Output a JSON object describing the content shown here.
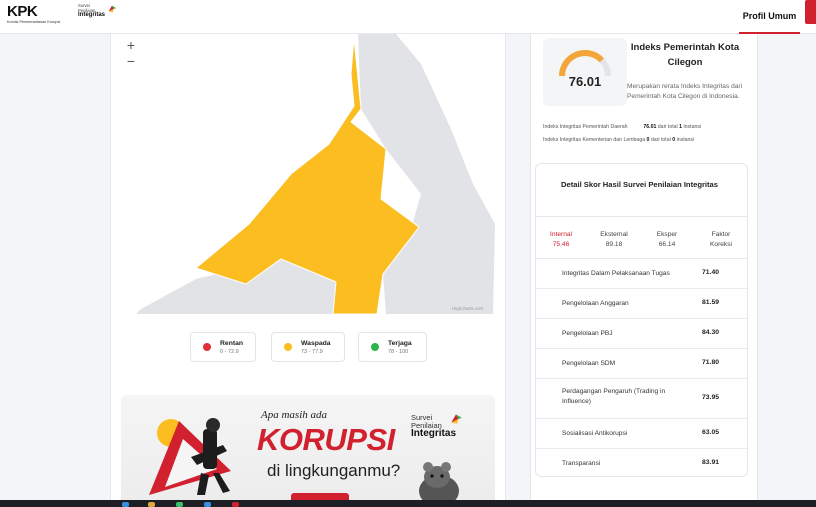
{
  "header": {
    "kpk_logo_text": "KPK",
    "kpk_logo_sub": "Komisi Pemberantasan Korupsi",
    "spi_logo": {
      "line1": "Survei",
      "line2": "Penilaian",
      "line3": "Integritas"
    },
    "nav_active": "Profil Umum",
    "accent_color": "#d1202e"
  },
  "map": {
    "zoom_in": "+",
    "zoom_out": "−",
    "credit": "Highcharts.com",
    "region_color": "#fbbd1f",
    "neighbor_color": "#e2e3e6"
  },
  "legend": [
    {
      "label": "Rentan",
      "range": "0 - 72.9",
      "color": "#e0303a"
    },
    {
      "label": "Waspada",
      "range": "73 - 77.9",
      "color": "#fbbd1f"
    },
    {
      "label": "Terjaga",
      "range": "78 - 100",
      "color": "#2bb54a"
    }
  ],
  "banner": {
    "tagline": "Apa masih ada",
    "headline": "KORUPSI",
    "subline": "di lingkunganmu?",
    "logo": {
      "line1": "Survei",
      "line2": "Penilaian",
      "line3": "Integritas"
    }
  },
  "index": {
    "value": "76.01",
    "title": "Indeks Pemerintah Kota Cilegon",
    "description": "Merupakan rerata Indeks Integritas dari Pemerintah Kota Cilegon di Indonesia.",
    "line1_label": "Indeks Integritas Pemerintah Daerah",
    "line1_value": "76.01",
    "line1_suffix": "dari total",
    "line1_count": "1",
    "line1_unit": "instansi",
    "line2_label": "Indeks Integritas Kementerian dan Lembaga",
    "line2_value": "0",
    "line2_suffix": "dari total",
    "line2_count": "0",
    "line2_unit": "instansi",
    "gauge_fraction": 0.7601
  },
  "detail": {
    "title": "Detail Skor Hasil Survei Penilaian Integritas",
    "tabs": [
      {
        "label": "Internal",
        "value": "75.46",
        "active": true
      },
      {
        "label": "Eksternal",
        "value": "89.18",
        "active": false
      },
      {
        "label": "Eksper",
        "value": "66.14",
        "active": false
      },
      {
        "label": "Faktor",
        "value": "Koreksi",
        "active": false
      }
    ],
    "rows": [
      {
        "name": "Integritas Dalam Pelaksanaan Tugas",
        "value": "71.40"
      },
      {
        "name": "Pengelolaan Anggaran",
        "value": "81.59"
      },
      {
        "name": "Pengelolaan PBJ",
        "value": "84.30"
      },
      {
        "name": "Pengelolaan SDM",
        "value": "71.80"
      },
      {
        "name": "Perdagangan Pengaruh (Trading in Influence)",
        "value": "73.95"
      },
      {
        "name": "Sosialisasi Antikorupsi",
        "value": "63.05"
      },
      {
        "name": "Transparansi",
        "value": "83.91"
      }
    ]
  }
}
